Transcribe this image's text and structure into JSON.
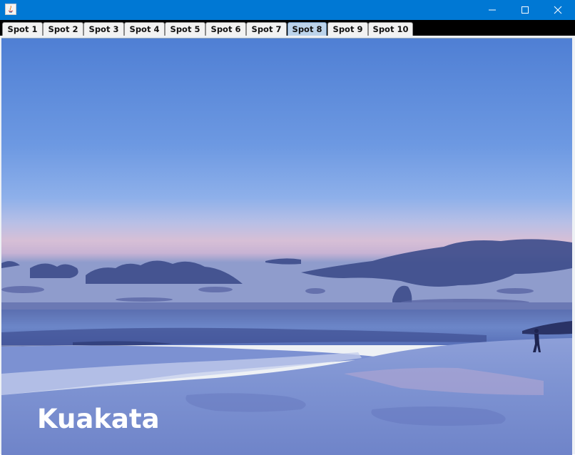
{
  "window": {
    "controls": [
      "minimize-icon",
      "maximize-icon",
      "close-icon"
    ],
    "titlebar_color": "#0078d4"
  },
  "tabs": [
    {
      "label": "Spot 1",
      "selected": false
    },
    {
      "label": "Spot 2",
      "selected": false
    },
    {
      "label": "Spot 3",
      "selected": false
    },
    {
      "label": "Spot 4",
      "selected": false
    },
    {
      "label": "Spot 5",
      "selected": false
    },
    {
      "label": "Spot 6",
      "selected": false
    },
    {
      "label": "Spot 7",
      "selected": false
    },
    {
      "label": "Spot 8",
      "selected": true
    },
    {
      "label": "Spot 9",
      "selected": false
    },
    {
      "label": "Spot 10",
      "selected": false
    }
  ],
  "content": {
    "caption": "Kuakata"
  }
}
